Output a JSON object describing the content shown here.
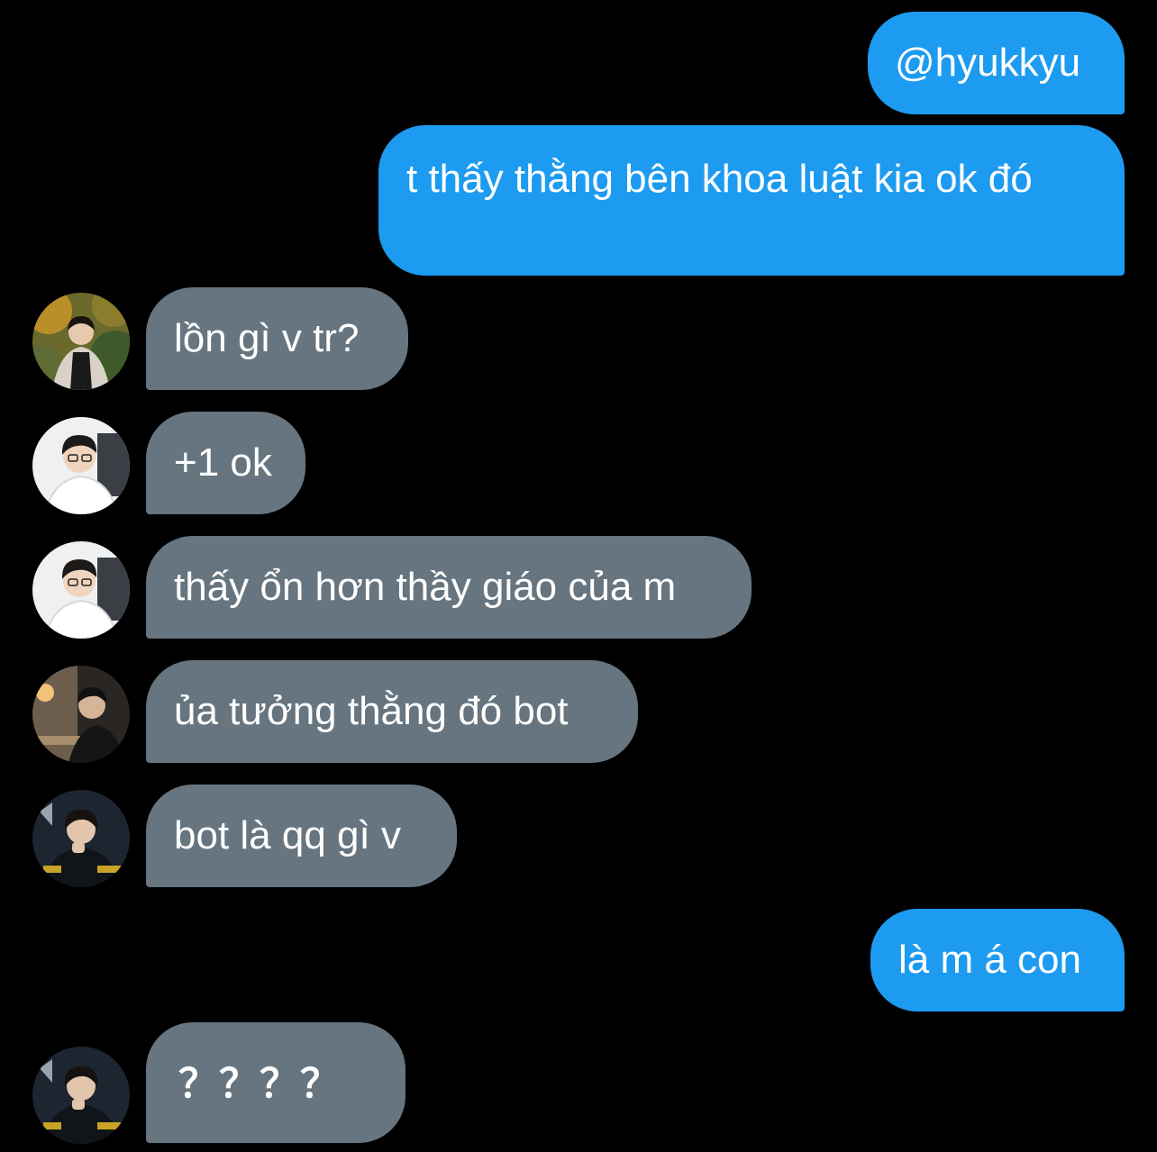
{
  "colors": {
    "background": "#000000",
    "sent_bubble": "#1d9bf0",
    "received_bubble": "#66757f",
    "text": "#ffffff"
  },
  "messages": [
    {
      "direction": "sent",
      "text": "@hyukkyu"
    },
    {
      "direction": "sent",
      "text": "t thấy thằng bên khoa luật kia ok đó"
    },
    {
      "direction": "received",
      "avatar": "avatar-user-1",
      "text": "lồn gì v tr?"
    },
    {
      "direction": "received",
      "avatar": "avatar-user-2",
      "text": "+1 ok"
    },
    {
      "direction": "received",
      "avatar": "avatar-user-2",
      "text": "thấy ổn hơn thầy giáo của m"
    },
    {
      "direction": "received",
      "avatar": "avatar-user-3",
      "text": "ủa tưởng thằng đó bot"
    },
    {
      "direction": "received",
      "avatar": "avatar-user-4",
      "text": "bot là qq gì v"
    },
    {
      "direction": "sent",
      "text": "là m á con"
    },
    {
      "direction": "received",
      "avatar": "avatar-user-4",
      "text": "？？？？"
    }
  ]
}
